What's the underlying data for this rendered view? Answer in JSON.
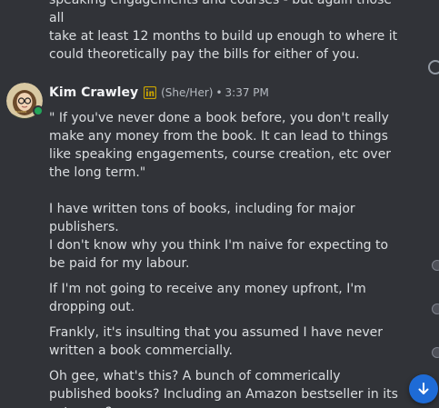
{
  "previous_message": {
    "lines": [
      "speaking engagements and courses - but again those all",
      "take at least 12 months to build up enough to where it",
      "could theoretically pay the bills for either of you."
    ]
  },
  "message": {
    "author": "Kim Crawley",
    "badge_icon": "linkedin-icon",
    "pronouns": "(She/Her)",
    "separator": "•",
    "timestamp": "3:37 PM",
    "status": "online",
    "paragraphs": [
      "\" If you've never done a book before, you don't really make any money from the book. It can lead to things like speaking engagements, course creation, etc over the long term.\"",
      "I have written tons of books, including for major publishers.",
      "I don't know  why you think I'm naive for expecting to be paid for my labour.",
      "If I'm not going to receive any money upfront, I'm dropping out.",
      "Frankly, it's insulting that you assumed I have never written a book commercially.",
      "Oh gee, what's this? A bunch of commerically published books? Including an Amazon bestseller in its category?"
    ]
  },
  "colors": {
    "background": "#313338",
    "text": "#dbdee1",
    "username": "#f2f3f5",
    "muted": "#b5bac1",
    "online": "#23a55a",
    "linkedin": "#c8a300",
    "jump_button": "#1e6bd6"
  },
  "jump_button": {
    "icon": "arrow-down-icon"
  }
}
